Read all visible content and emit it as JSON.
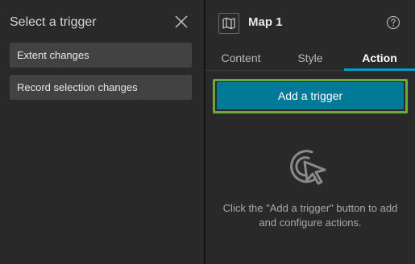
{
  "trigger_panel": {
    "title": "Select a trigger",
    "close_icon": "close-icon",
    "items": [
      {
        "label": "Extent changes"
      },
      {
        "label": "Record selection changes"
      }
    ]
  },
  "widget_panel": {
    "icon": "map-icon",
    "title": "Map 1",
    "help_icon": "help-icon",
    "tabs": [
      {
        "label": "Content",
        "active": false
      },
      {
        "label": "Style",
        "active": false
      },
      {
        "label": "Action",
        "active": true
      }
    ],
    "add_trigger_label": "Add a trigger",
    "empty_state_icon": "pointer-target-icon",
    "empty_state_text": "Click the \"Add a trigger\" button to add and configure actions."
  },
  "colors": {
    "panel_bg": "#292929",
    "item_bg": "#424242",
    "accent": "#00a0c6",
    "button_bg": "#007a96",
    "highlight_outline": "#6fa93a"
  }
}
